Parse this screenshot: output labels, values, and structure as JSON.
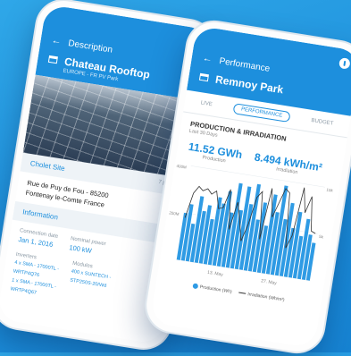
{
  "left_phone": {
    "header": {
      "back_icon": "arrow-left-icon",
      "title": "Description",
      "site_name": "Chateau Rooftop",
      "site_sub": "EUROPE - FR PV Park"
    },
    "site_section": {
      "title": "Cholet Site",
      "meta": "7 plants",
      "address": "Rue de Puy de Fou - 85200 Fontenay le-Comte France"
    },
    "information": {
      "title": "Information",
      "connection_label": "Connection date",
      "connection_value": "Jan 1, 2016",
      "power_label": "Nominal power",
      "power_value": "100 kW",
      "inverters_label": "Inverters",
      "inverters_lines": [
        "4 x SMA - 17000TL -",
        "WRTP4Q76",
        "1 x SMA - 17000TL -",
        "WRTP4Q67"
      ],
      "modules_label": "Modules",
      "modules_lines": [
        "400 x SUNTECH -",
        "STP250S-20/Wd"
      ]
    }
  },
  "right_phone": {
    "header": {
      "back_icon": "arrow-left-icon",
      "title": "Performance",
      "park_name": "Remnoy Park"
    },
    "tabs": [
      "LIVE",
      "PERFORMANCE",
      "BUDGET"
    ],
    "active_tab": "PERFORMANCE",
    "section_title": "PRODUCTION & IRRADIATION",
    "section_sub": "Last 30 Days",
    "production": {
      "value": "11.52 GWh",
      "label": "Production"
    },
    "irradiation": {
      "value": "8.494 kWh/m²",
      "label": "Irradiation"
    },
    "chart_data": {
      "type": "bar",
      "x_labels": [
        "13. May",
        "27. May"
      ],
      "y_left_labels": [
        "400M",
        "200M"
      ],
      "y_right_labels": [
        "10k",
        "5k"
      ],
      "series": [
        {
          "name": "Production (Wh)",
          "color": "#2f9be4",
          "values": [
            50,
            60,
            40,
            70,
            55,
            62,
            48,
            72,
            66,
            80,
            58,
            90,
            62,
            88,
            70,
            92,
            55,
            74,
            50,
            84,
            66,
            95,
            60,
            78,
            52,
            70,
            45,
            64,
            48,
            40
          ]
        },
        {
          "name": "Irradiation (Wh/m²)",
          "color": "#333333",
          "values": [
            45,
            72,
            80,
            76,
            79,
            74,
            78,
            60,
            62,
            82,
            40,
            70,
            52,
            30,
            48,
            78,
            85,
            35,
            90,
            60,
            76,
            92,
            88,
            30,
            44,
            96,
            70,
            88,
            52,
            50
          ]
        }
      ],
      "legend": [
        "Production (Wh)",
        "Irradiation (Wh/m²)"
      ]
    }
  }
}
